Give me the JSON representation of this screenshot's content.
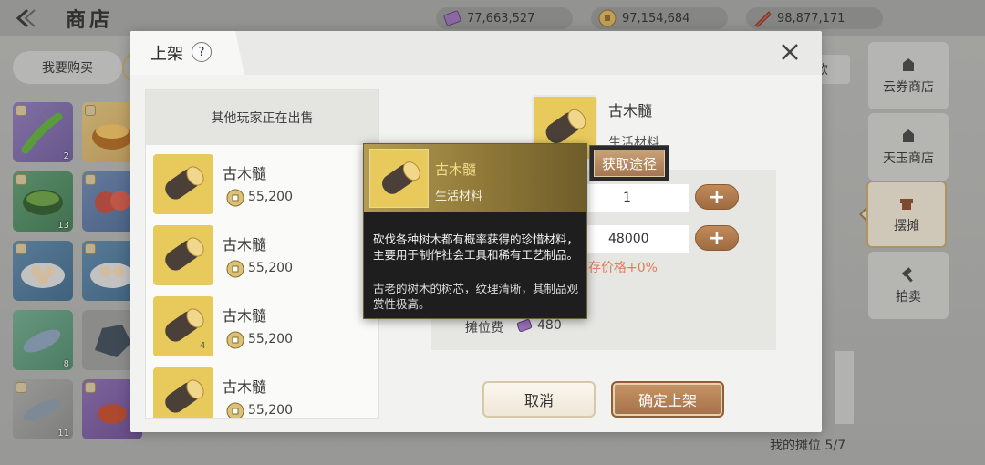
{
  "shop": {
    "title": "商店",
    "currencies": [
      {
        "icon": "ticket-currency-icon",
        "value": "77,663,527"
      },
      {
        "icon": "gold-coin-icon",
        "value": "97,154,684"
      },
      {
        "icon": "jade-feather-icon",
        "value": "98,877,171"
      }
    ],
    "buy_tab": "我要购买",
    "style_tab": "款",
    "grid_quantities": [
      "2",
      "13",
      "8",
      "11"
    ],
    "side_items": [
      {
        "label": "云券商店",
        "icon": "shop-icon"
      },
      {
        "label": "天玉商店",
        "icon": "shop-icon"
      },
      {
        "label": "摆摊",
        "icon": "stall-icon"
      },
      {
        "label": "拍卖",
        "icon": "hammer-icon"
      }
    ],
    "my_stall": "我的摊位 5/7"
  },
  "modal": {
    "title": "上架",
    "help": "?",
    "list_header": "其他玩家正在出售",
    "listings": [
      {
        "name": "古木髓",
        "price": "55,200"
      },
      {
        "name": "古木髓",
        "price": "55,200"
      },
      {
        "name": "古木髓",
        "price": "55,200",
        "qty": "4"
      },
      {
        "name": "古木髓",
        "price": "55,200"
      }
    ],
    "item": {
      "name": "古木髓",
      "type": "生活材料"
    },
    "quantity": "1",
    "price": "48000",
    "price_hint": "存价格+0%",
    "plus": "+",
    "fee_label": "摊位费",
    "fee_value": "480",
    "cancel": "取消",
    "confirm": "确定上架"
  },
  "tooltip": {
    "name": "古木髓",
    "type": "生活材料",
    "desc1": "砍伐各种树木都有概率获得的珍惜材料，主要用于制作社会工具和稀有工艺制品。",
    "desc2": "古老的树木的树芯，纹理清晰，其制品观赏性极高。",
    "source_button": "获取途径"
  },
  "colors": {
    "accent": "#a3704a",
    "hint": "#e07b5a",
    "tooltip_title": "#f3dd8a"
  }
}
